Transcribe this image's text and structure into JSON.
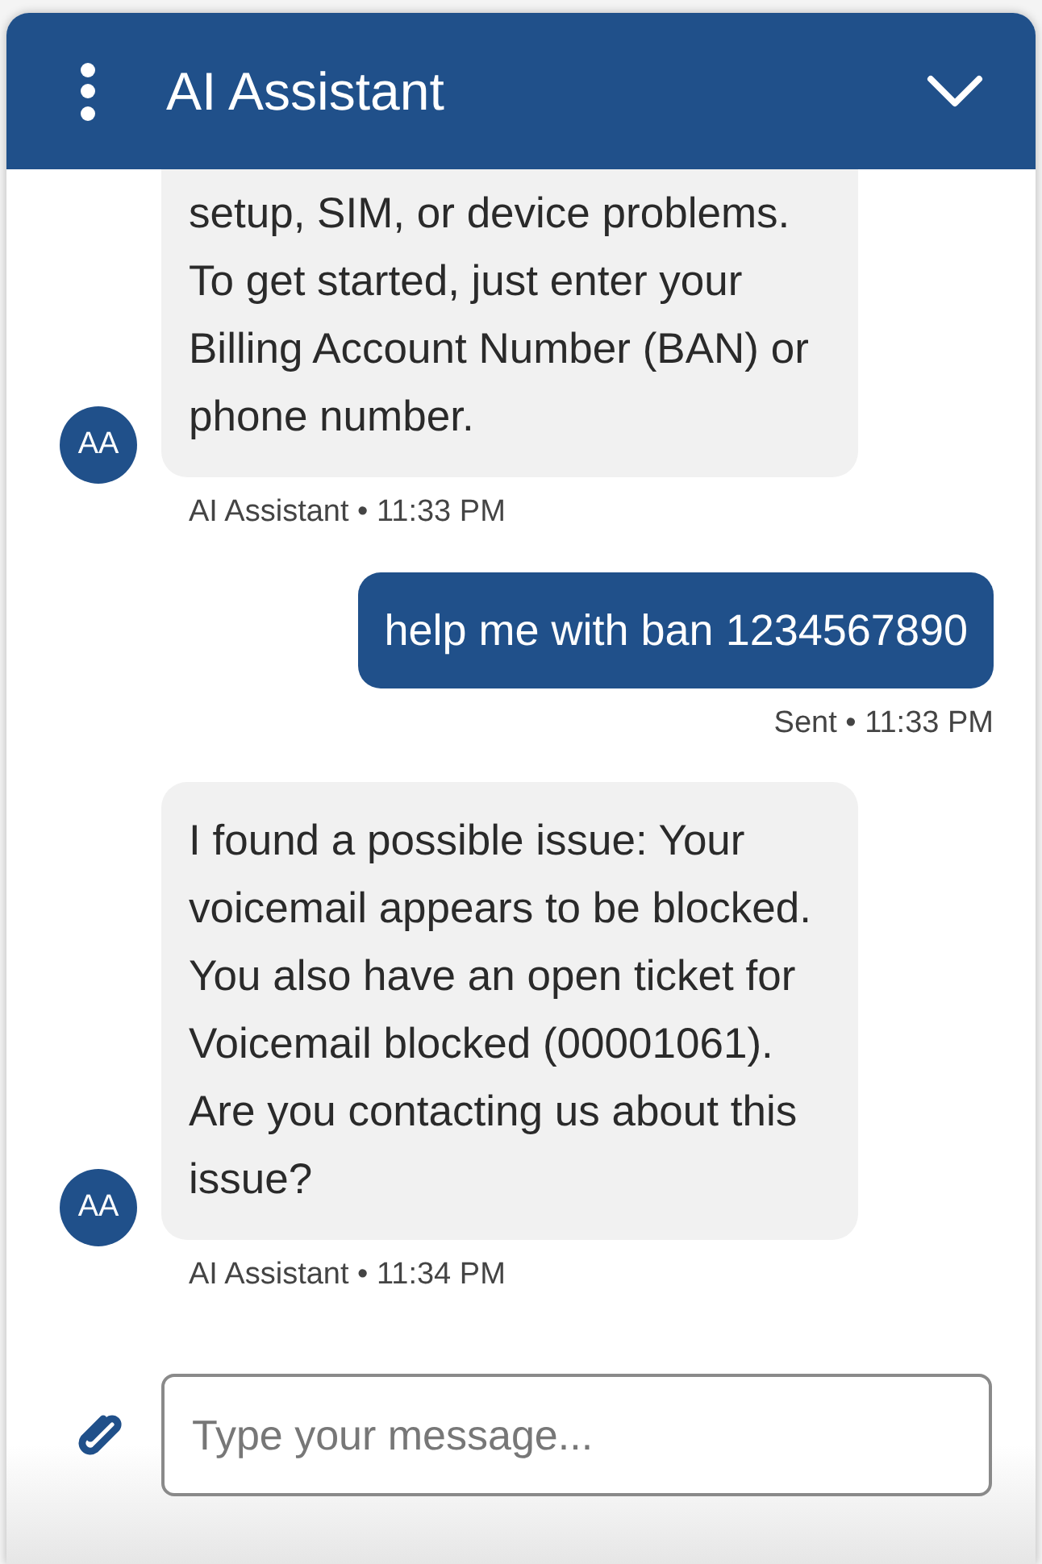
{
  "header": {
    "title": "AI Assistant"
  },
  "messages": [
    {
      "kind": "bot",
      "avatar": "AA",
      "text": "setup, SIM, or device problems. To get started, just enter your Billing Account Number (BAN) or phone number.",
      "meta": "AI Assistant • 11:33 PM"
    },
    {
      "kind": "user",
      "text": "help me with ban 1234567890",
      "meta": "Sent • 11:33 PM"
    },
    {
      "kind": "bot",
      "avatar": "AA",
      "text": "I found a possible issue: Your voicemail appears to be blocked. You also have an open ticket for Voicemail blocked (00001061).\nAre you contacting us about this issue?",
      "meta": "AI Assistant • 11:34 PM"
    }
  ],
  "composer": {
    "placeholder": "Type your message..."
  }
}
